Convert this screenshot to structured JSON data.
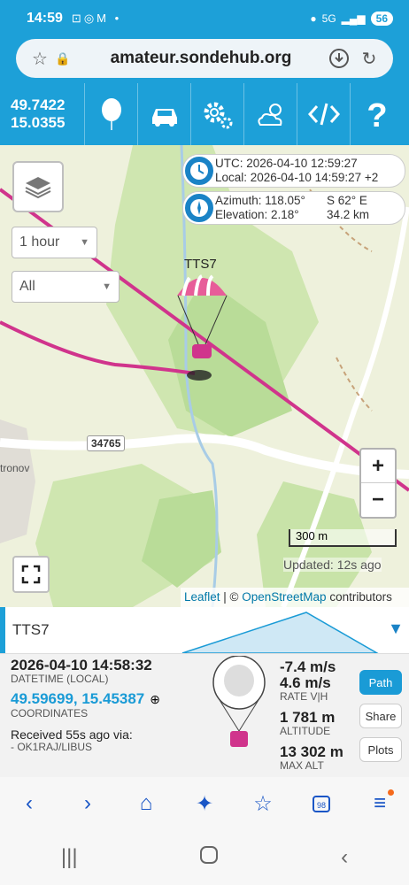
{
  "statusbar": {
    "time": "14:59",
    "icons": "⊡◎M •",
    "signal": "5G",
    "battery": "56"
  },
  "browser": {
    "url": "amateur.sondehub.org"
  },
  "toolbar": {
    "lat": "49.7422",
    "lon": "15.0355"
  },
  "map": {
    "timerange": "1 hour",
    "filter": "All",
    "utc": "UTC: 2026-04-10 12:59:27",
    "local": "Local: 2026-04-10 14:59:27 +2",
    "azimuth": "Azimuth: 118.05°",
    "direction": "S 62° E",
    "elevation": "Elevation: 2.18°",
    "distance": "34.2 km",
    "payload_label": "TTS7",
    "road_number": "34765",
    "town": "tronov",
    "scale": "300 m",
    "updated": "Updated: 12s ago",
    "attrib_leaflet": "Leaflet",
    "attrib_sep": " | © ",
    "attrib_osm": "OpenStreetMap",
    "attrib_rest": " contributors",
    "zoom_in": "+",
    "zoom_out": "−"
  },
  "panel": {
    "title": "TTS7",
    "datetime": "2026-04-10 14:58:32",
    "datetime_label": "DATETIME (LOCAL)",
    "coordinates": "49.59699, 15.45387",
    "coordinates_label": "COORDINATES",
    "received": "Received 55s ago via:",
    "receiver": "- OK1RAJ/LIBUS",
    "rate_v": "-7.4 m/s",
    "rate_h": "4.6 m/s",
    "rate_label": "RATE V|H",
    "altitude": "1 781 m",
    "altitude_label": "ALTITUDE",
    "max_alt": "13 302 m",
    "max_alt_label": "MAX ALT",
    "btn_path": "Path",
    "btn_share": "Share",
    "btn_plots": "Plots"
  },
  "colors": {
    "brand": "#1da0d8",
    "accent": "#1a9bd6",
    "track": "#d0348c"
  }
}
